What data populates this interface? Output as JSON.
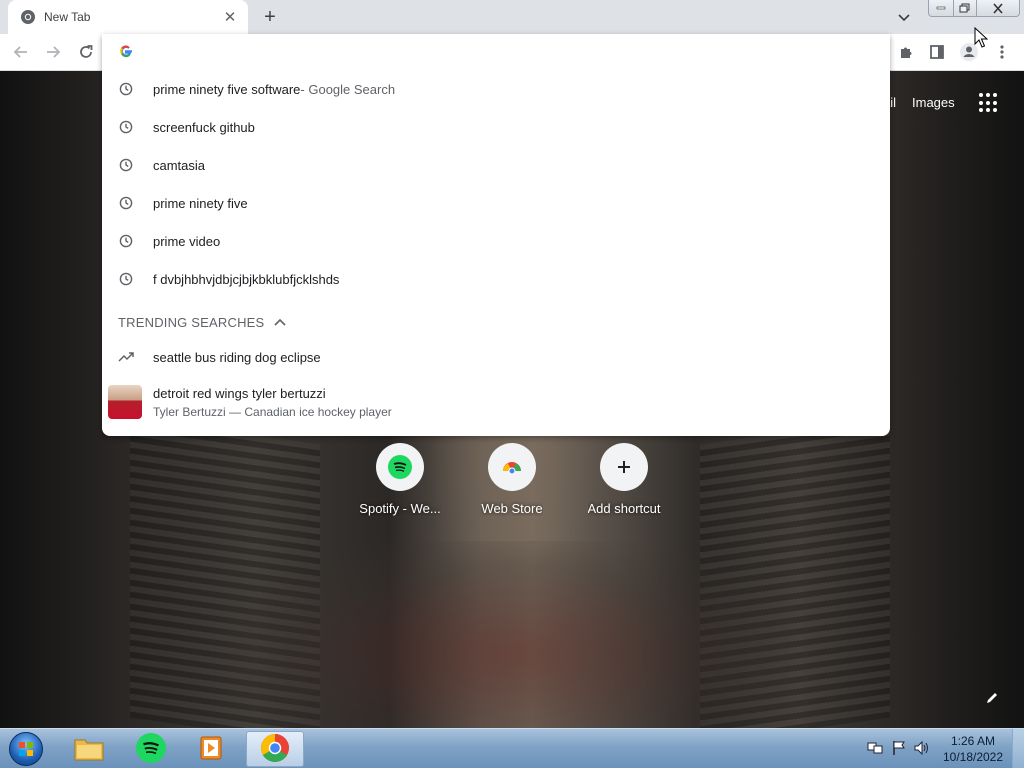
{
  "tab": {
    "title": "New Tab"
  },
  "omnibox": {
    "value": "",
    "suggestions": [
      {
        "text": "prime ninety five software",
        "sub": " - Google Search",
        "icon": "history-icon"
      },
      {
        "text": "screenfuck github",
        "sub": "",
        "icon": "history-icon"
      },
      {
        "text": "camtasia",
        "sub": "",
        "icon": "history-icon"
      },
      {
        "text": "prime ninety five",
        "sub": "",
        "icon": "history-icon"
      },
      {
        "text": "prime video",
        "sub": "",
        "icon": "history-icon"
      },
      {
        "text": "f dvbjhbhvjdbjcjbjkbklubfjcklshds",
        "sub": "",
        "icon": "history-icon"
      }
    ],
    "trending_header": "TRENDING SEARCHES",
    "trending": [
      {
        "text": "seattle bus riding dog eclipse",
        "icon": "trending-icon"
      }
    ],
    "entity": {
      "title": "detroit red wings tyler bertuzzi",
      "subtitle": "Tyler Bertuzzi — Canadian ice hockey player"
    }
  },
  "ntp": {
    "links": {
      "gmail_partial": "ail",
      "images": "Images"
    },
    "shortcuts": [
      {
        "label": "Spotify - We...",
        "icon": "spotify-icon"
      },
      {
        "label": "Web Store",
        "icon": "chrome-web-store-icon"
      },
      {
        "label": "Add shortcut",
        "icon": "plus-icon"
      }
    ]
  },
  "taskbar": {
    "clock_time": "1:26 AM",
    "clock_date": "10/18/2022"
  },
  "colors": {
    "spotify_green": "#1ed760",
    "chrome_blue": "#4285f4",
    "chrome_red": "#ea4335",
    "chrome_yellow": "#fbbc04",
    "chrome_green": "#34a853"
  }
}
